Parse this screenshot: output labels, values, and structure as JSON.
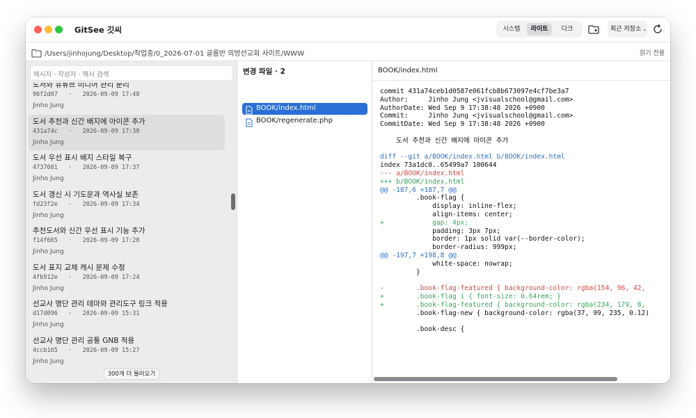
{
  "app": {
    "title": "GitSee 깃씨"
  },
  "theme": {
    "options": [
      "시스템",
      "라이트",
      "다크"
    ],
    "selected": "라이트"
  },
  "toolbar": {
    "recent_save_label": "최근 저장소",
    "recent_chevron": "⌄",
    "folder_icon": "folder-add-icon",
    "refresh_icon": "refresh-icon"
  },
  "path": {
    "text": "/Users/jinhojung/Desktop/작업중/0_2026-07-01 골롬반 외방선교회 사이트/WWW",
    "readonly_label": "읽기 전용"
  },
  "search": {
    "placeholder": "메시지 · 작성자 · 해시 검색"
  },
  "commits": [
    {
      "message": "도서와 유튜브 미디어 관리 분리",
      "hash": "96f2d07",
      "date": "2026-09-09 17:48",
      "author": "Jinho Jung"
    },
    {
      "message": "도서 추천과 신간 배지에 아이콘 추가",
      "hash": "431a74c",
      "date": "2026-09-09 17:38",
      "author": "Jinho Jung"
    },
    {
      "message": "도서 우선 표시 배지 스타일 복구",
      "hash": "4737601",
      "date": "2026-09-09 17:37",
      "author": "Jinho Jung"
    },
    {
      "message": "도서 갱신 시 기도문과 역사실 보존",
      "hash": "fd23f2e",
      "date": "2026-09-09 17:34",
      "author": "Jinho Jung"
    },
    {
      "message": "추천도서와 신간 우선 표시 기능 추가",
      "hash": "f14f665",
      "date": "2026-09-09 17:28",
      "author": "Jinho Jung"
    },
    {
      "message": "도서 표지 교체 캐시 문제 수정",
      "hash": "4fb912e",
      "date": "2026-09-09 17:24",
      "author": "Jinho Jung"
    },
    {
      "message": "선교사 명단 관리 테마와 관리도구 링크 적용",
      "hash": "d17d096",
      "date": "2026-09-09 15:31",
      "author": "Jinho Jung"
    },
    {
      "message": "선교사 명단 관리 공통 GNB 적용",
      "hash": "4ccb165",
      "date": "2026-09-09 15:27",
      "author": "Jinho Jung"
    }
  ],
  "selected_commit": "431a74c",
  "load_more": "300개 더 불러오기",
  "changed_files": {
    "header": "변경 파일 · 2",
    "files": [
      "BOOK/index.html",
      "BOOK/regenerate.php"
    ],
    "selected": "BOOK/index.html"
  },
  "diff": {
    "file": "BOOK/index.html",
    "lines": [
      {
        "type": "ctx",
        "text": "commit 431a74ceb1d0587e061fcb8b673097e4cf7be3a7"
      },
      {
        "type": "ctx",
        "text": "Author:     Jinho Jung <jvisualschool@gmail.com>"
      },
      {
        "type": "ctx",
        "text": "AuthorDate: Wed Sep 9 17:38:48 2026 +0900"
      },
      {
        "type": "ctx",
        "text": "Commit:     Jinho Jung <jvisualschool@gmail.com>"
      },
      {
        "type": "ctx",
        "text": "CommitDate: Wed Sep 9 17:38:48 2026 +0900"
      },
      {
        "type": "ctx",
        "text": ""
      },
      {
        "type": "ctx",
        "text": "    도서 추천과 신간 배지에 아이콘 추가"
      },
      {
        "type": "ctx",
        "text": ""
      },
      {
        "type": "hdr",
        "text": "diff --git a/BOOK/index.html b/BOOK/index.html"
      },
      {
        "type": "ctx",
        "text": "index 73a1dc0..65499a7 100644"
      },
      {
        "type": "del",
        "text": "--- a/BOOK/index.html"
      },
      {
        "type": "add",
        "text": "+++ b/BOOK/index.html"
      },
      {
        "type": "hunk",
        "text": "@@ -187,6 +187,7 @@"
      },
      {
        "type": "ctx",
        "text": "         .book-flag {"
      },
      {
        "type": "ctx",
        "text": "             display: inline-flex;"
      },
      {
        "type": "ctx",
        "text": "             align-items: center;"
      },
      {
        "type": "add",
        "text": "+            gap: 4px;"
      },
      {
        "type": "ctx",
        "text": "             padding: 3px 7px;"
      },
      {
        "type": "ctx",
        "text": "             border: 1px solid var(--border-color);"
      },
      {
        "type": "ctx",
        "text": "             border-radius: 999px;"
      },
      {
        "type": "hunk",
        "text": "@@ -197,7 +198,8 @@"
      },
      {
        "type": "ctx",
        "text": "             white-space: nowrap;"
      },
      {
        "type": "ctx",
        "text": "         }"
      },
      {
        "type": "ctx",
        "text": ""
      },
      {
        "type": "del",
        "text": "-        .book-flag-featured { background-color: rgba(154, 96, 42,"
      },
      {
        "type": "add",
        "text": "+        .book-flag i { font-size: 0.64rem; }"
      },
      {
        "type": "add",
        "text": "+        .book-flag-featured { background-color: rgba(234, 179, 8,"
      },
      {
        "type": "ctx",
        "text": "         .book-flag-new { background-color: rgba(37, 99, 235, 0.12)"
      },
      {
        "type": "ctx",
        "text": ""
      },
      {
        "type": "ctx",
        "text": "         .book-desc {"
      }
    ]
  }
}
